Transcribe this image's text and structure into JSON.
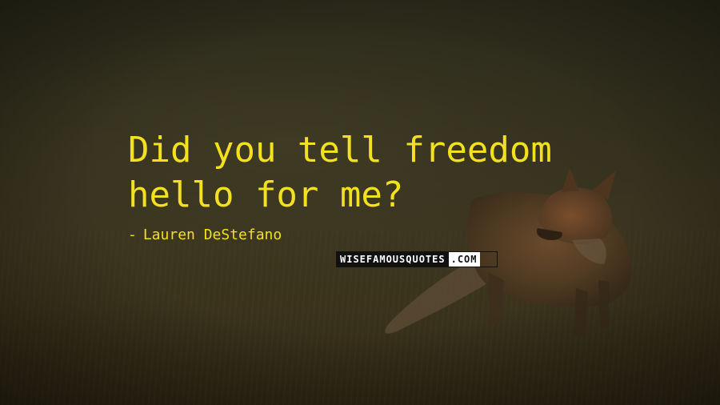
{
  "quote": {
    "lines": [
      "Did you tell freedom",
      "hello for me?"
    ]
  },
  "author": {
    "dash": "-",
    "name": "Lauren DeStefano"
  },
  "watermark": {
    "main": "WISEFAMOUSQUOTES",
    "suffix": ".COM"
  },
  "colors": {
    "text": "#f2e021",
    "background": "#2e2b1a"
  },
  "background": {
    "subject": "fox-in-grass"
  }
}
